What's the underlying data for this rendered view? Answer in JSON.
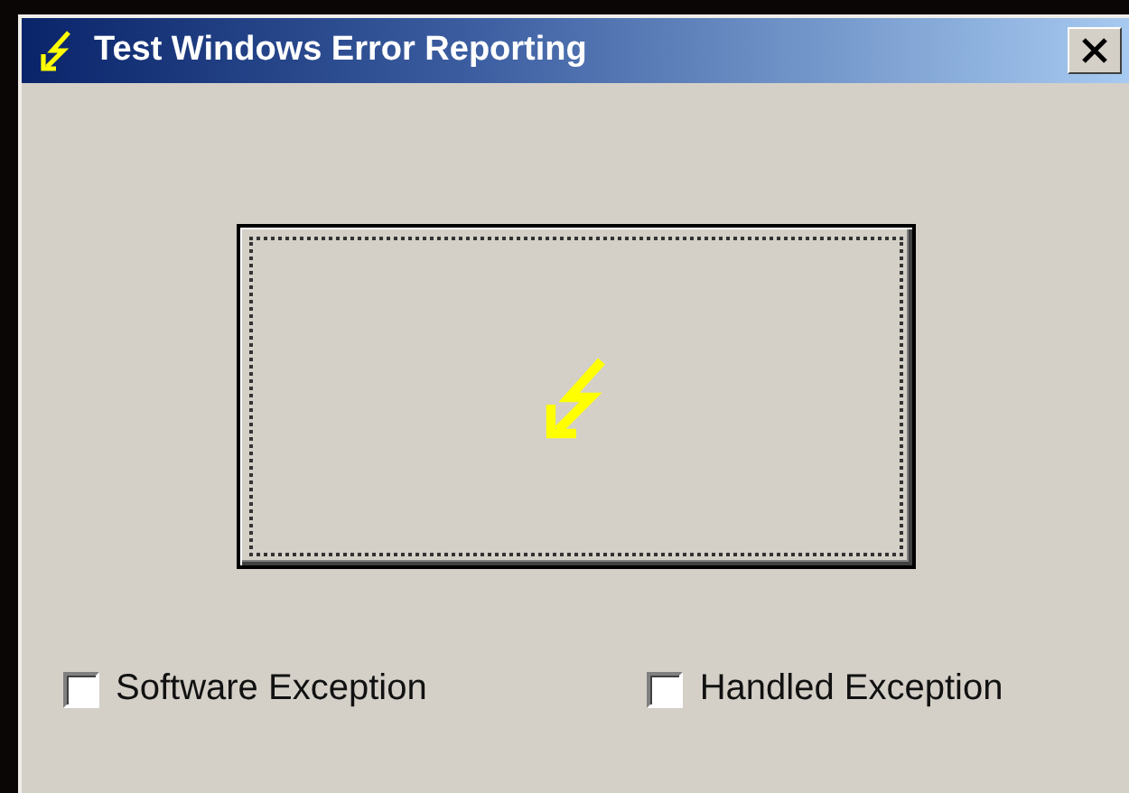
{
  "window": {
    "title": "Test Windows Error Reporting"
  },
  "trigger_button": {
    "focused": true
  },
  "checkboxes": [
    {
      "label": "Software Exception",
      "checked": false
    },
    {
      "label": "Handled Exception",
      "checked": false
    }
  ]
}
